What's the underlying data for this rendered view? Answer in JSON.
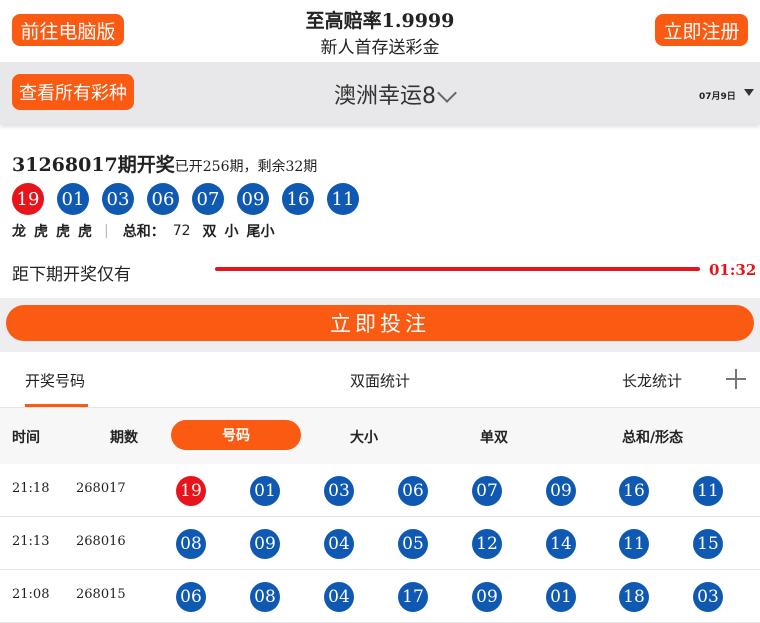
{
  "header": {
    "pc_button": "前往电脑版",
    "promo_line1": "至高赔率1.9999",
    "promo_line2": "新人首存送彩金",
    "register_button": "立即注册"
  },
  "selector": {
    "all_lotteries_button": "查看所有彩种",
    "lottery_name": "澳洲幸运8",
    "date": "07月9日"
  },
  "draw": {
    "issue_title": "31268017期开奖",
    "issue_sub": "已开256期，剩余32期",
    "balls": [
      {
        "n": "19",
        "color": "red"
      },
      {
        "n": "01",
        "color": "blue"
      },
      {
        "n": "03",
        "color": "blue"
      },
      {
        "n": "06",
        "color": "blue"
      },
      {
        "n": "07",
        "color": "blue"
      },
      {
        "n": "09",
        "color": "blue"
      },
      {
        "n": "16",
        "color": "blue"
      },
      {
        "n": "11",
        "color": "blue"
      }
    ],
    "dragon_tiger": [
      "龙",
      "虎",
      "虎",
      "虎"
    ],
    "sum_label": "总和：",
    "sum_value": "72",
    "attrs": [
      "双",
      "小",
      "尾小"
    ],
    "countdown_label": "距下期开奖仅有",
    "countdown": "01:32",
    "bet_button": "立即投注"
  },
  "tabs": [
    "开奖号码",
    "双面统计",
    "长龙统计"
  ],
  "table": {
    "headers": [
      "时间",
      "期数",
      "号码",
      "大小",
      "单双",
      "总和/形态"
    ],
    "rows": [
      {
        "time": "21:18",
        "issue": "268017",
        "balls": [
          "19",
          "01",
          "03",
          "06",
          "07",
          "09",
          "16",
          "11"
        ]
      },
      {
        "time": "21:13",
        "issue": "268016",
        "balls": [
          "08",
          "09",
          "04",
          "05",
          "12",
          "14",
          "11",
          "15"
        ]
      },
      {
        "time": "21:08",
        "issue": "268015",
        "balls": [
          "06",
          "08",
          "04",
          "17",
          "09",
          "01",
          "18",
          "03"
        ]
      }
    ]
  },
  "colors": {
    "accent": "#fb5a12",
    "ball_blue": "#1059b3",
    "ball_red": "#e8141c"
  }
}
